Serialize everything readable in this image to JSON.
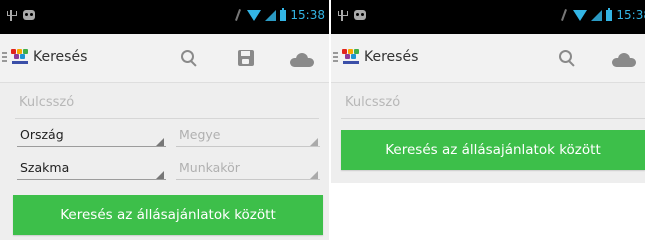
{
  "colors": {
    "status_bar": "#000000",
    "status_accent": "#33b5e5",
    "action_bar": "#f2f2f2",
    "content_bg": "#eeeeee",
    "button_green": "#3dbf4a",
    "button_text": "#ffffff"
  },
  "icons": [
    "usb-icon",
    "notification-icon",
    "signal-off-icon",
    "wifi-icon",
    "cell-signal-icon",
    "battery-icon",
    "menu-icon",
    "app-logo",
    "search-icon",
    "save-icon",
    "cloud-icon",
    "dropdown-arrow-icon"
  ],
  "screen_left": {
    "status_bar": {
      "time": "15:38"
    },
    "action_bar": {
      "title": "Keresés"
    },
    "form": {
      "keyword_placeholder": "Kulcsszó",
      "country_value": "Ország",
      "county_hint": "Megye",
      "profession_value": "Szakma",
      "job_hint": "Munkakör",
      "search_button": "Keresés az állásajánlatok között"
    }
  },
  "screen_right": {
    "status_bar": {
      "time": "15:38"
    },
    "action_bar": {
      "title": "Keresés"
    },
    "form": {
      "keyword_placeholder": "Kulcsszó",
      "search_button": "Keresés az állásajánlatok között"
    }
  }
}
